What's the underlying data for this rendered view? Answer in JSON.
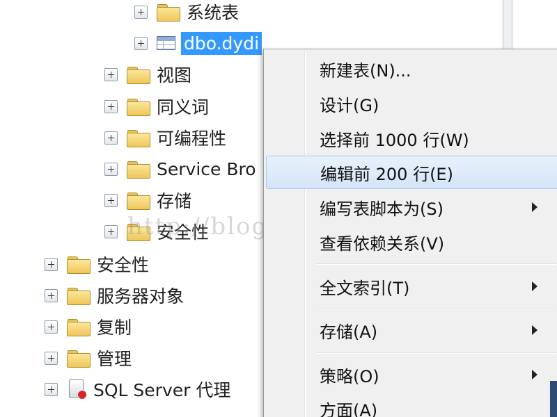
{
  "tree": {
    "items": [
      {
        "label": "系统表",
        "icon": "folder-icon"
      },
      {
        "label": "dbo.dydi",
        "icon": "table-icon",
        "selected": true
      },
      {
        "label": "视图",
        "icon": "folder-icon"
      },
      {
        "label": "同义词",
        "icon": "folder-icon"
      },
      {
        "label": "可编程性",
        "icon": "folder-icon"
      },
      {
        "label": "Service Bro",
        "icon": "folder-icon"
      },
      {
        "label": "存储",
        "icon": "folder-icon"
      },
      {
        "label": "安全性",
        "icon": "folder-icon"
      },
      {
        "label": "安全性",
        "icon": "folder-icon"
      },
      {
        "label": "服务器对象",
        "icon": "folder-icon"
      },
      {
        "label": "复制",
        "icon": "folder-icon"
      },
      {
        "label": "管理",
        "icon": "folder-icon"
      },
      {
        "label": "SQL Server 代理",
        "icon": "sql-agent-icon"
      }
    ]
  },
  "context_menu": {
    "items": [
      {
        "label": "新建表(N)...",
        "submenu": false
      },
      {
        "label": "设计(G)",
        "submenu": false
      },
      {
        "label": "选择前 1000 行(W)",
        "submenu": false
      },
      {
        "label": "编辑前 200 行(E)",
        "submenu": false,
        "hovered": true
      },
      {
        "label": "编写表脚本为(S)",
        "submenu": true
      },
      {
        "label": "查看依赖关系(V)",
        "submenu": false
      },
      {
        "label": "全文索引(T)",
        "submenu": true
      },
      {
        "label": "存储(A)",
        "submenu": true
      },
      {
        "label": "策略(O)",
        "submenu": true
      },
      {
        "label": "方面(A)",
        "submenu": false
      }
    ]
  },
  "watermark": "http://blog.csdn.net/",
  "colors": {
    "selection": "#3399ff",
    "menu_background": "#f0f0f0",
    "menu_hover": "#d4e5f8",
    "folder": "#efc65a"
  }
}
